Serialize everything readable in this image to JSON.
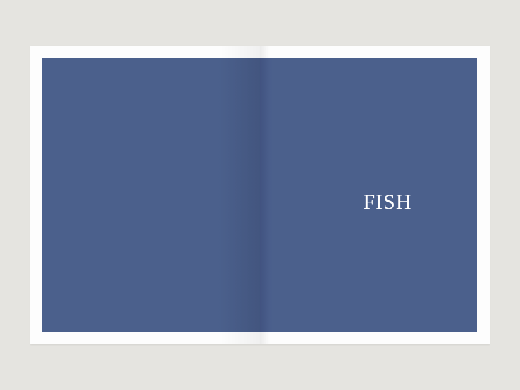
{
  "spread": {
    "right_page": {
      "title": "FISH"
    }
  },
  "colors": {
    "background": "#e5e4e0",
    "paper": "#fdfdfd",
    "panel": "#4b608c",
    "title_text": "#ffffff"
  }
}
